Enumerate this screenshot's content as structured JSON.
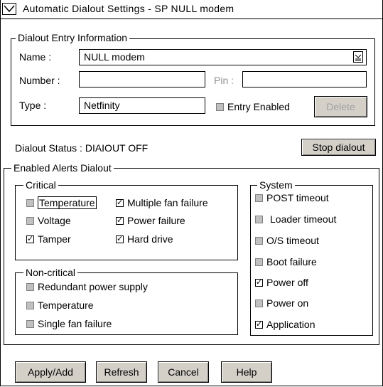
{
  "window": {
    "title": "Automatic Dialout Settings - SP NULL modem"
  },
  "entry": {
    "legend": "Dialout Entry Information",
    "name_label": "Name :",
    "name_value": "NULL modem",
    "number_label": "Number :",
    "number_value": "",
    "pin_label": "Pin :",
    "pin_value": "",
    "type_label": "Type :",
    "type_value": "Netfinity",
    "entry_enabled_label": "Entry Enabled",
    "entry_enabled_checked": false,
    "delete_label": "Delete"
  },
  "status": {
    "text": "Dialout Status : DIAIOUT OFF",
    "stop_label": "Stop dialout"
  },
  "alerts": {
    "legend": "Enabled Alerts Dialout",
    "critical": {
      "legend": "Critical",
      "items": [
        {
          "label": "Temperature",
          "checked": false
        },
        {
          "label": "Multiple fan failure",
          "checked": true
        },
        {
          "label": "Voltage",
          "checked": false
        },
        {
          "label": "Power failure",
          "checked": true
        },
        {
          "label": "Tamper",
          "checked": true
        },
        {
          "label": "Hard drive",
          "checked": true
        }
      ]
    },
    "noncritical": {
      "legend": "Non-critical",
      "items": [
        {
          "label": "Redundant power supply",
          "checked": false
        },
        {
          "label": "Temperature",
          "checked": false
        },
        {
          "label": "Single fan failure",
          "checked": false
        }
      ]
    },
    "system": {
      "legend": "System",
      "items": [
        {
          "label": "POST timeout",
          "checked": false
        },
        {
          "label": "Loader timeout",
          "checked": false
        },
        {
          "label": "O/S timeout",
          "checked": false
        },
        {
          "label": "Boot failure",
          "checked": false
        },
        {
          "label": "Power off",
          "checked": true
        },
        {
          "label": "Power on",
          "checked": false
        },
        {
          "label": "Application",
          "checked": true
        }
      ]
    }
  },
  "buttons": {
    "apply_label": "Apply/Add",
    "refresh_label": "Refresh",
    "cancel_label": "Cancel",
    "help_label": "Help"
  }
}
